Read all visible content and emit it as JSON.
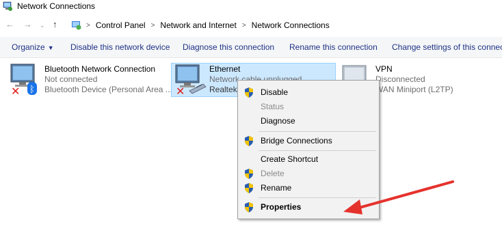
{
  "window": {
    "title": "Network Connections"
  },
  "breadcrumb": {
    "items": [
      "Control Panel",
      "Network and Internet",
      "Network Connections"
    ]
  },
  "toolbar": {
    "organize": "Organize",
    "disable": "Disable this network device",
    "diagnose": "Diagnose this connection",
    "rename": "Rename this connection",
    "change": "Change settings of this connecti"
  },
  "connections": [
    {
      "name": "Bluetooth Network Connection",
      "status": "Not connected",
      "device": "Bluetooth Device (Personal Area ...",
      "icon": "bluetooth-adapter-icon"
    },
    {
      "name": "Ethernet",
      "status": "Network cable unplugged",
      "device": "Realtek",
      "icon": "ethernet-adapter-icon"
    },
    {
      "name": "VPN",
      "status": "Disconnected",
      "device": "WAN Miniport (L2TP)",
      "icon": "vpn-adapter-icon"
    }
  ],
  "context_menu": {
    "items": [
      {
        "label": "Disable",
        "shield": true,
        "enabled": true,
        "bold": false
      },
      {
        "label": "Status",
        "shield": false,
        "enabled": false,
        "bold": false
      },
      {
        "label": "Diagnose",
        "shield": false,
        "enabled": true,
        "bold": false
      },
      {
        "label": "Bridge Connections",
        "shield": true,
        "enabled": true,
        "bold": false
      },
      {
        "label": "Create Shortcut",
        "shield": false,
        "enabled": true,
        "bold": false
      },
      {
        "label": "Delete",
        "shield": true,
        "enabled": false,
        "bold": false
      },
      {
        "label": "Rename",
        "shield": true,
        "enabled": true,
        "bold": false
      },
      {
        "label": "Properties",
        "shield": true,
        "enabled": true,
        "bold": true
      }
    ]
  },
  "colors": {
    "selection": "#cce8ff",
    "link": "#1e3287",
    "arrow": "#e5322d"
  }
}
